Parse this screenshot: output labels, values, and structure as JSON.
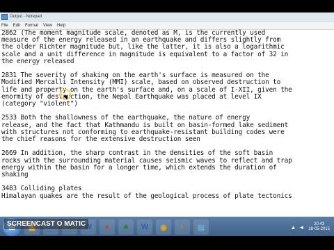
{
  "window": {
    "title": "Output - Notepad"
  },
  "menu": [
    "File",
    "Edit",
    "Format",
    "View",
    "Help"
  ],
  "paragraphs": [
    "2862    (The moment magnitude scale, denoted as M, is the currently used\nmeasure of the energy released in an earthquake and differs slightly from\nthe older Richter magnitude but, like the latter, it is also a logarithmic\nscale and a unit difference in magnitude is equivalent to a factor of 32 in\nthe energy released",
    "2831    The severity of shaking on the earth's surface is measured on the\nModified Mercalli Intensity (MMI) scale, based on observed destruction to\nlife and property on the earth's surface and, on a scale of I-XII, given the\nenormity of destruction, the Nepal Earthquake was placed at level IX\n(category \"violent\")",
    "2533    Both the shallowness of the earthquake, the nature of energy\nrelease, and the fact that Kathmandu is built on basin-formed lake sediment\nwith structures not conforming to earthquake-resistant building codes were\nthe chief reasons for the extensive destruction seen",
    "2669    In addition, the sharp contrast in the densities of the soft basin\nrocks with the surrounding material causes seismic waves to reflect and trap\nenergy within the basin for a longer time, which extends the duration of\nshaking",
    "3483    Colliding plates\nHimalayan quakes are the result of the geological process of plate tectonics"
  ],
  "taskbar": {
    "apps": [
      {
        "icon": "folder-icon",
        "glyph": "▣",
        "color": "#e8b84a"
      },
      {
        "icon": "media-player-icon",
        "glyph": "▶",
        "color": "#3f7fd0"
      },
      {
        "icon": "excel-icon",
        "glyph": "X",
        "color": "#1f8a3e"
      },
      {
        "icon": "word-icon",
        "glyph": "W",
        "color": "#2b5fb4"
      },
      {
        "icon": "record-icon",
        "glyph": "●",
        "color": "#d83a2f"
      },
      {
        "icon": "game-icon",
        "glyph": "♣",
        "color": "#2f7d32"
      },
      {
        "icon": "word-icon-2",
        "glyph": "W",
        "color": "#2b5fb4"
      },
      {
        "icon": "chrome-icon",
        "glyph": "◉",
        "color": "#d9a62b"
      },
      {
        "icon": "firefox-icon",
        "glyph": "◐",
        "color": "#e06a22"
      },
      {
        "icon": "notepad-icon",
        "glyph": "▤",
        "color": "#6ea6d8"
      }
    ],
    "clock_time": "20:43",
    "clock_date": "28-05-2015"
  },
  "watermark": "SCREENCAST O MATIC"
}
